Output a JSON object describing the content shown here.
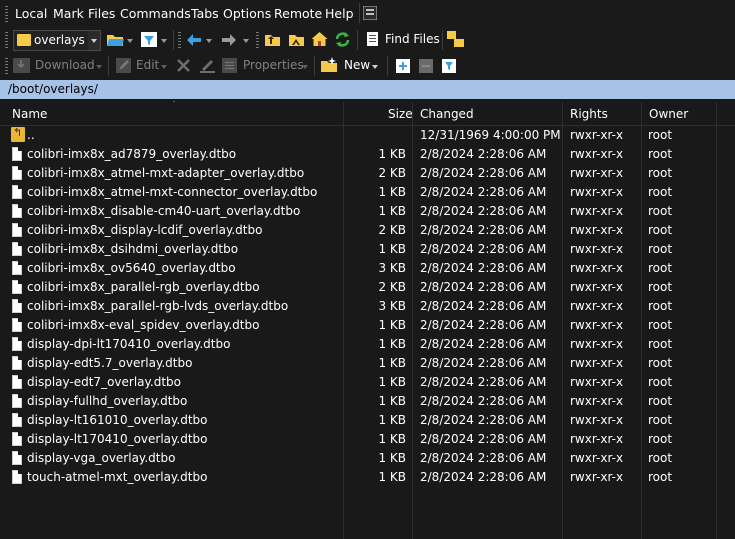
{
  "menu": [
    "Local",
    "Mark",
    "Files",
    "Commands",
    "Tabs",
    "Options",
    "Remote",
    "Help"
  ],
  "toolbar": {
    "path_combo_value": "overlays",
    "find_files_label": "Find Files",
    "download_label": "Download",
    "edit_label": "Edit",
    "properties_label": "Properties",
    "new_label": "New"
  },
  "address": "/boot/overlays/",
  "columns": {
    "name": "Name",
    "size": "Size",
    "changed": "Changed",
    "rights": "Rights",
    "owner": "Owner"
  },
  "parent_row": {
    "name": "..",
    "changed": "12/31/1969 4:00:00 PM",
    "rights": "rwxr-xr-x",
    "owner": "root"
  },
  "files": [
    {
      "name": "colibri-imx8x_ad7879_overlay.dtbo",
      "size": "1 KB",
      "changed": "2/8/2024 2:28:06 AM",
      "rights": "rwxr-xr-x",
      "owner": "root"
    },
    {
      "name": "colibri-imx8x_atmel-mxt-adapter_overlay.dtbo",
      "size": "2 KB",
      "changed": "2/8/2024 2:28:06 AM",
      "rights": "rwxr-xr-x",
      "owner": "root"
    },
    {
      "name": "colibri-imx8x_atmel-mxt-connector_overlay.dtbo",
      "size": "1 KB",
      "changed": "2/8/2024 2:28:06 AM",
      "rights": "rwxr-xr-x",
      "owner": "root"
    },
    {
      "name": "colibri-imx8x_disable-cm40-uart_overlay.dtbo",
      "size": "1 KB",
      "changed": "2/8/2024 2:28:06 AM",
      "rights": "rwxr-xr-x",
      "owner": "root"
    },
    {
      "name": "colibri-imx8x_display-lcdif_overlay.dtbo",
      "size": "2 KB",
      "changed": "2/8/2024 2:28:06 AM",
      "rights": "rwxr-xr-x",
      "owner": "root"
    },
    {
      "name": "colibri-imx8x_dsihdmi_overlay.dtbo",
      "size": "1 KB",
      "changed": "2/8/2024 2:28:06 AM",
      "rights": "rwxr-xr-x",
      "owner": "root"
    },
    {
      "name": "colibri-imx8x_ov5640_overlay.dtbo",
      "size": "3 KB",
      "changed": "2/8/2024 2:28:06 AM",
      "rights": "rwxr-xr-x",
      "owner": "root"
    },
    {
      "name": "colibri-imx8x_parallel-rgb_overlay.dtbo",
      "size": "2 KB",
      "changed": "2/8/2024 2:28:06 AM",
      "rights": "rwxr-xr-x",
      "owner": "root"
    },
    {
      "name": "colibri-imx8x_parallel-rgb-lvds_overlay.dtbo",
      "size": "3 KB",
      "changed": "2/8/2024 2:28:06 AM",
      "rights": "rwxr-xr-x",
      "owner": "root"
    },
    {
      "name": "colibri-imx8x-eval_spidev_overlay.dtbo",
      "size": "1 KB",
      "changed": "2/8/2024 2:28:06 AM",
      "rights": "rwxr-xr-x",
      "owner": "root"
    },
    {
      "name": "display-dpi-lt170410_overlay.dtbo",
      "size": "1 KB",
      "changed": "2/8/2024 2:28:06 AM",
      "rights": "rwxr-xr-x",
      "owner": "root"
    },
    {
      "name": "display-edt5.7_overlay.dtbo",
      "size": "1 KB",
      "changed": "2/8/2024 2:28:06 AM",
      "rights": "rwxr-xr-x",
      "owner": "root"
    },
    {
      "name": "display-edt7_overlay.dtbo",
      "size": "1 KB",
      "changed": "2/8/2024 2:28:06 AM",
      "rights": "rwxr-xr-x",
      "owner": "root"
    },
    {
      "name": "display-fullhd_overlay.dtbo",
      "size": "1 KB",
      "changed": "2/8/2024 2:28:06 AM",
      "rights": "rwxr-xr-x",
      "owner": "root"
    },
    {
      "name": "display-lt161010_overlay.dtbo",
      "size": "1 KB",
      "changed": "2/8/2024 2:28:06 AM",
      "rights": "rwxr-xr-x",
      "owner": "root"
    },
    {
      "name": "display-lt170410_overlay.dtbo",
      "size": "1 KB",
      "changed": "2/8/2024 2:28:06 AM",
      "rights": "rwxr-xr-x",
      "owner": "root"
    },
    {
      "name": "display-vga_overlay.dtbo",
      "size": "1 KB",
      "changed": "2/8/2024 2:28:06 AM",
      "rights": "rwxr-xr-x",
      "owner": "root"
    },
    {
      "name": "touch-atmel-mxt_overlay.dtbo",
      "size": "1 KB",
      "changed": "2/8/2024 2:28:06 AM",
      "rights": "rwxr-xr-x",
      "owner": "root"
    }
  ],
  "colors": {
    "background": "#191919",
    "address_bar": "#a6c2e6",
    "folder": "#f5c94a",
    "accent_blue": "#3aa0e0",
    "refresh_green": "#3bb54a"
  }
}
